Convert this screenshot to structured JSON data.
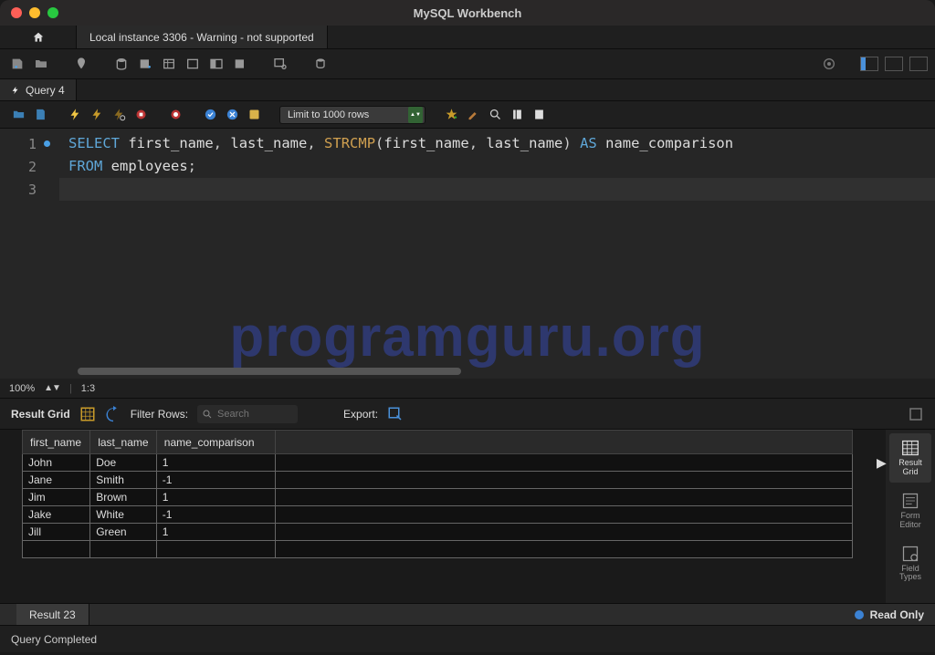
{
  "window": {
    "title": "MySQL Workbench"
  },
  "connection_tab": "Local instance 3306 - Warning - not supported",
  "query_tab": {
    "label": "Query 4"
  },
  "editor": {
    "limit_label": "Limit to 1000 rows",
    "sql_tok": {
      "select": "SELECT",
      "from": "FROM",
      "as": "AS",
      "first_name": "first_name",
      "last_name": "last_name",
      "strcmp": "STRCMP",
      "name_comparison": "name_comparison",
      "employees": "employees"
    },
    "line_numbers": [
      "1",
      "2",
      "3"
    ]
  },
  "editor_status": {
    "zoom": "100%",
    "pos": "1:3"
  },
  "result_toolbar": {
    "label_result_grid": "Result Grid",
    "label_filter": "Filter Rows:",
    "search_placeholder": "Search",
    "label_export": "Export:"
  },
  "grid": {
    "columns": [
      "first_name",
      "last_name",
      "name_comparison"
    ],
    "rows": [
      [
        "John",
        "Doe",
        "1"
      ],
      [
        "Jane",
        "Smith",
        "-1"
      ],
      [
        "Jim",
        "Brown",
        "1"
      ],
      [
        "Jake",
        "White",
        "-1"
      ],
      [
        "Jill",
        "Green",
        "1"
      ]
    ]
  },
  "side_tabs": {
    "result_grid": "Result\nGrid",
    "form_editor": "Form\nEditor",
    "field_types": "Field\nTypes"
  },
  "result_tab": "Result 23",
  "readonly": "Read Only",
  "footer": "Query Completed",
  "watermark": "programguru.org"
}
